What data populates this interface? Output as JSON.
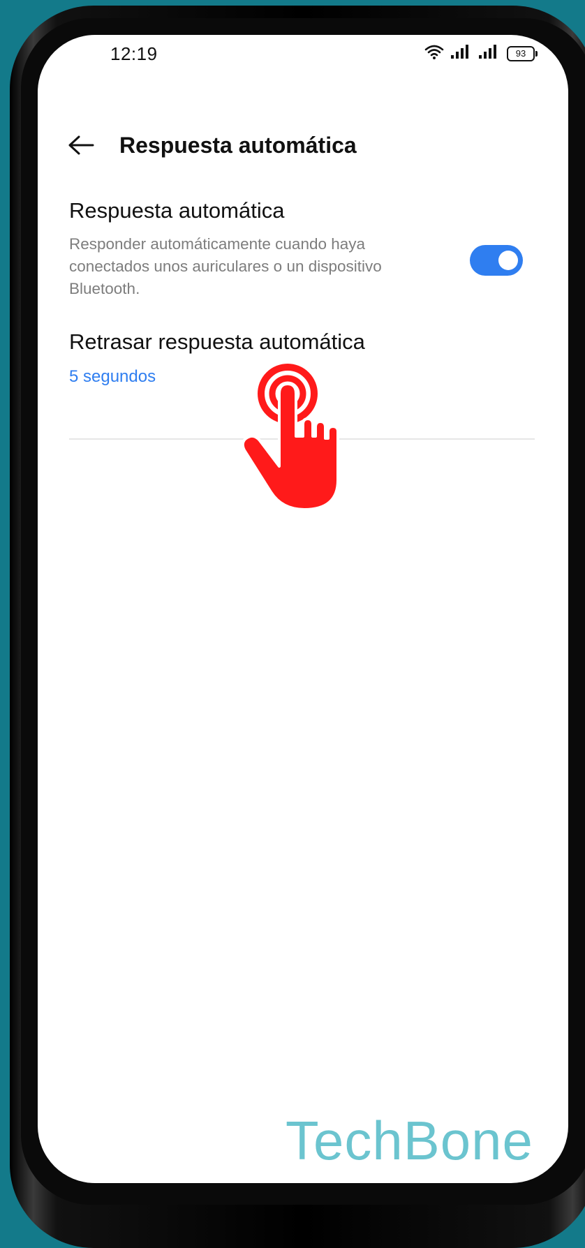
{
  "status_bar": {
    "time": "12:19",
    "battery": "93"
  },
  "header": {
    "title": "Respuesta automática"
  },
  "settings": {
    "auto_answer": {
      "title": "Respuesta automática",
      "description": "Responder automáticamente cuando haya conectados unos auriculares o un dispositivo Bluetooth.",
      "enabled": true
    },
    "delay": {
      "title": "Retrasar respuesta automática",
      "value": "5 segundos"
    }
  },
  "colors": {
    "accent": "#2f7ef0",
    "background": "#137a8a",
    "tap_indicator": "#ff1a1a",
    "watermark": "#6bc4cf"
  },
  "watermark": {
    "text": "TechBone"
  }
}
